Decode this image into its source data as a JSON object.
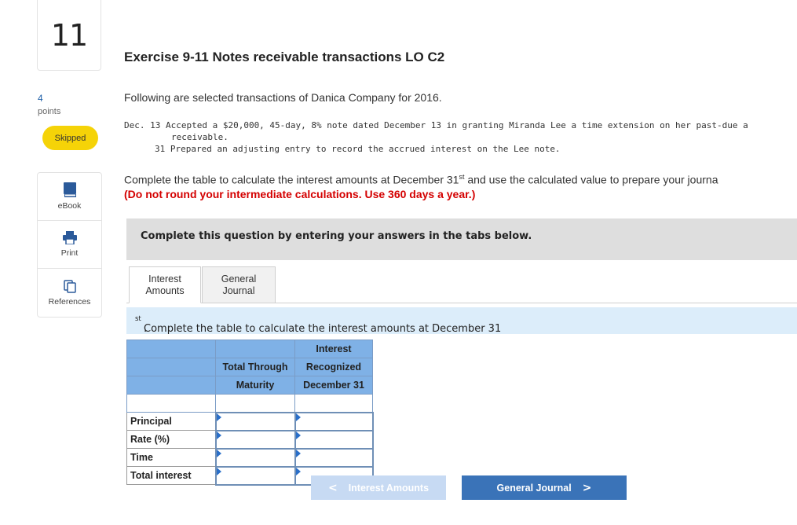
{
  "question": {
    "number": "11",
    "points_value": "4",
    "points_label": "points",
    "status": "Skipped"
  },
  "sidebar": {
    "tools": [
      {
        "label": "eBook",
        "icon": "book-icon"
      },
      {
        "label": "Print",
        "icon": "printer-icon"
      },
      {
        "label": "References",
        "icon": "references-icon"
      }
    ]
  },
  "exercise": {
    "title": "Exercise 9-11 Notes receivable transactions LO C2",
    "intro": "Following are selected transactions of Danica Company for 2016.",
    "transactions": {
      "line1": "Dec. 13 Accepted a $20,000, 45-day, 8% note dated December 13 in granting Miranda Lee a time extension on her past-due a",
      "line1_cont": "receivable.",
      "line2": "31 Prepared an adjusting entry to record the accrued interest on the Lee note."
    },
    "instruction_pre": "Complete the table to calculate the interest amounts at December 31",
    "instruction_sup": "st",
    "instruction_post": " and use the calculated value to prepare your journa",
    "instruction_red": "(Do not round your intermediate calculations. Use 360 days a year.)"
  },
  "banner": {
    "text": "Complete this question by entering your answers in the tabs below."
  },
  "tabs": [
    {
      "line1": "Interest",
      "line2": "Amounts",
      "active": true
    },
    {
      "line1": "General",
      "line2": "Journal",
      "active": false
    }
  ],
  "tab_banner": {
    "text_pre": "Complete the table to calculate the interest amounts at December 31",
    "text_sup": "st",
    "text_post": "."
  },
  "table": {
    "header": {
      "row1": [
        "",
        "",
        "Interest"
      ],
      "row2": [
        "",
        "Total Through",
        "Recognized"
      ],
      "row3": [
        "",
        "Maturity",
        "December 31"
      ]
    },
    "rows": [
      {
        "label": "Principal",
        "total": "",
        "recognized": ""
      },
      {
        "label": "Rate (%)",
        "total": "",
        "recognized": ""
      },
      {
        "label": "Time",
        "total": "",
        "recognized": ""
      },
      {
        "label": "Total interest",
        "total": "",
        "recognized": ""
      }
    ]
  },
  "nav": {
    "prev_label": "Interest Amounts",
    "prev_chevron": "<",
    "next_label": "General Journal",
    "next_chevron": ">"
  },
  "colors": {
    "accent": "#3a73b8",
    "skipped_badge": "#f5d308",
    "instruction_red": "#d40000",
    "table_header": "#7fb1e6"
  }
}
